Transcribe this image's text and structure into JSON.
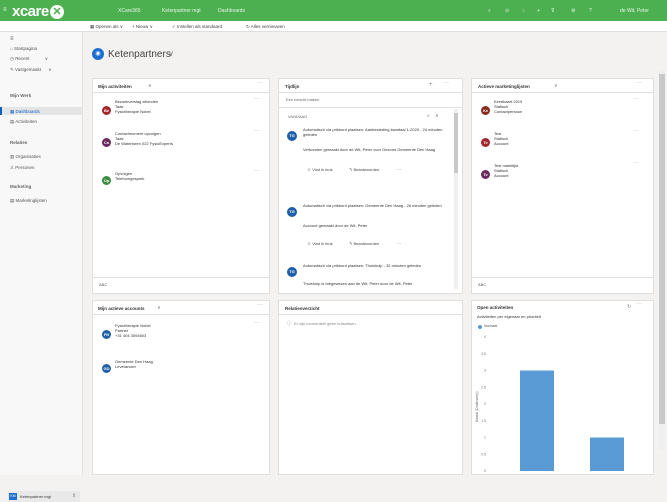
{
  "topbar": {
    "brand": "xcare",
    "app": "XCare365",
    "breadcrumb_1": "Ketenpartner mgt",
    "breadcrumb_2": "Dashboards",
    "user": "de Wit, Peter"
  },
  "commandbar": {
    "open": "Openen als",
    "new": "Nieuw",
    "set_default": "Instellen als standaard",
    "refresh": "Alles vernieuwen"
  },
  "sidebar": {
    "home": "Startpagina",
    "recent": "Recent",
    "pinned": "Vastgemaakt",
    "section_my_work": "Mijn Werk",
    "dashboards": "Dashboards",
    "activities": "Activiteiten",
    "section_relations": "Relaties",
    "organisations": "Organisaties",
    "persons": "Personen",
    "section_marketing": "Marketing",
    "marketinglists": "Marketinglijsten",
    "footer": "Ketenpartner mgt"
  },
  "page": {
    "title": "Ketenpartners"
  },
  "activities_panel": {
    "title": "Mijn activiteiten",
    "items": [
      {
        "initials": "Be",
        "color": "#a4262c",
        "title": "Bezoekverslag afronden",
        "sub1": "Taak",
        "sub2": "Fysiotherapie Nobel"
      },
      {
        "initials": "Co",
        "color": "#6b2a5f",
        "title": "Contactmoment opvolgen",
        "sub1": "Taak",
        "sub2": "De Watertoren 022 FysioExperts"
      },
      {
        "initials": "Op",
        "color": "#3a8c3f",
        "title": "Opvolgen",
        "sub1": "Telefoongesprek",
        "sub2": ""
      }
    ],
    "footer": "ABC"
  },
  "timeline_panel": {
    "title": "Tijdlijn",
    "placeholder": "Een bericht maken",
    "day": "VANDAAG",
    "entries": [
      {
        "initials": "TG",
        "text": "Automatisch via prikbord plaatsen: Aanbesteding kwartaal 1-2020 - 24 minuten geleden",
        "note": "Verbonden gemaakt door de Wit, Peter voor Gezond Gemeente Den Haag",
        "like": "Vind ik leuk",
        "reply": "Beantwoorden"
      },
      {
        "initials": "TG",
        "text": "Automatisch via prikbord plaatsen: Gemeente Den Haag - 26 minuten geleden",
        "note": "Account gemaakt door de Wit, Peter",
        "like": "Vind ik leuk",
        "reply": "Beantwoorden"
      },
      {
        "initials": "TG",
        "text": "Automatisch via prikbord plaatsen: Thuishulp - 32 minuten geleden",
        "note": "Thuishulp is toegewezen aan de Wit, Peter door de Wit, Peter",
        "like": "",
        "reply": ""
      }
    ]
  },
  "marketing_panel": {
    "title": "Actieve marketinglijsten",
    "items": [
      {
        "initials": "Ke",
        "color": "#8a2a1f",
        "title": "Kerstkaart 2019",
        "sub1": "Statisch",
        "sub2": "Contactpersoon"
      },
      {
        "initials": "Te",
        "color": "#a4262c",
        "title": "Test",
        "sub1": "Statisch",
        "sub2": "Account"
      },
      {
        "initials": "Te",
        "color": "#6b2a5f",
        "title": "Test marktlijst",
        "sub1": "Statisch",
        "sub2": "Account"
      }
    ],
    "footer": "ABC"
  },
  "accounts_panel": {
    "title": "Mijn actieve accounts",
    "items": [
      {
        "initials": "FN",
        "color": "#1f5fa8",
        "title": "Fysiotherapie Nobel",
        "sub1": "Partner",
        "sub2": "+31 404 3594603"
      },
      {
        "initials": "GD",
        "color": "#1f5fa8",
        "title": "Gemeente Den Haag",
        "sub1": "Leverancier",
        "sub2": ""
      }
    ]
  },
  "relations_panel": {
    "title": "Relatieoverzicht",
    "empty": "Er zijn momenteel geen huisartsen."
  },
  "open_activities_panel": {
    "title": "Open activiteiten",
    "subtitle": "Activiteiten per eigenaar en prioriteit",
    "legend": "Normaal"
  },
  "chart_data": {
    "type": "bar",
    "title": "Activiteiten per eigenaar en prioriteit",
    "ylabel": "Aantal (Onderwerp)",
    "ylim": [
      0,
      4
    ],
    "yticks": [
      "4",
      "3.5",
      "3",
      "2.5",
      "2",
      "1.5",
      "1",
      "0.5",
      "0"
    ],
    "series": [
      {
        "name": "Normaal",
        "values": [
          3,
          1
        ]
      }
    ],
    "colors": {
      "Normaal": "#5b9bd5"
    }
  }
}
